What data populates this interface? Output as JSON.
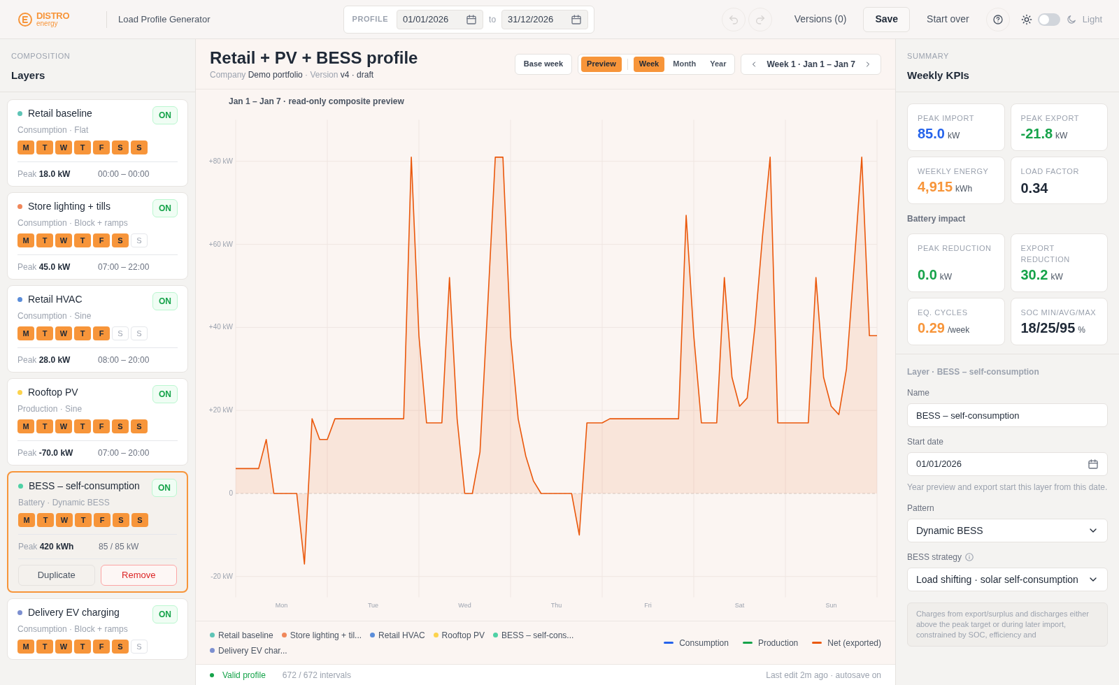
{
  "brand": {
    "name": "DISTRO",
    "sub": "energy"
  },
  "app_title": "Load Profile Generator",
  "profile_range": {
    "label": "PROFILE",
    "from": "01/01/2026",
    "to_label": "to",
    "to": "31/12/2026"
  },
  "toolbar": {
    "undo_disabled": true,
    "redo_disabled": true,
    "versions": "Versions (0)",
    "save": "Save",
    "start_over": "Start over",
    "theme_label": "Light",
    "dark": false
  },
  "sidebar": {
    "eyebrow": "COMPOSITION",
    "title": "Layers",
    "layers": [
      {
        "name": "Retail baseline",
        "color": "#5ec4b6",
        "subtitle": "Consumption · Flat",
        "on": true,
        "on_label": "ON",
        "selected": false,
        "days": [
          {
            "label": "M",
            "active": true
          },
          {
            "label": "T",
            "active": true
          },
          {
            "label": "W",
            "active": true
          },
          {
            "label": "T",
            "active": true
          },
          {
            "label": "F",
            "active": true
          },
          {
            "label": "S",
            "active": true
          },
          {
            "label": "S",
            "active": true
          }
        ],
        "peak_label": "Peak",
        "peak": "18.0 kW",
        "detail": "00:00 – 00:00"
      },
      {
        "name": "Store lighting + tills",
        "color": "#f0875a",
        "subtitle": "Consumption · Block + ramps",
        "on": true,
        "on_label": "ON",
        "selected": false,
        "days": [
          {
            "label": "M",
            "active": true
          },
          {
            "label": "T",
            "active": true
          },
          {
            "label": "W",
            "active": true
          },
          {
            "label": "T",
            "active": true
          },
          {
            "label": "F",
            "active": true
          },
          {
            "label": "S",
            "active": true
          },
          {
            "label": "S",
            "active": false
          }
        ],
        "peak_label": "Peak",
        "peak": "45.0 kW",
        "detail": "07:00 – 22:00"
      },
      {
        "name": "Retail HVAC",
        "color": "#5b8dd9",
        "subtitle": "Consumption · Sine",
        "on": true,
        "on_label": "ON",
        "selected": false,
        "days": [
          {
            "label": "M",
            "active": true
          },
          {
            "label": "T",
            "active": true
          },
          {
            "label": "W",
            "active": true
          },
          {
            "label": "T",
            "active": true
          },
          {
            "label": "F",
            "active": true
          },
          {
            "label": "S",
            "active": false
          },
          {
            "label": "S",
            "active": false
          }
        ],
        "peak_label": "Peak",
        "peak": "28.0 kW",
        "detail": "08:00 – 20:00"
      },
      {
        "name": "Rooftop PV",
        "color": "#fcd34d",
        "subtitle": "Production · Sine",
        "on": true,
        "on_label": "ON",
        "selected": false,
        "days": [
          {
            "label": "M",
            "active": true
          },
          {
            "label": "T",
            "active": true
          },
          {
            "label": "W",
            "active": true
          },
          {
            "label": "T",
            "active": true
          },
          {
            "label": "F",
            "active": true
          },
          {
            "label": "S",
            "active": true
          },
          {
            "label": "S",
            "active": true
          }
        ],
        "peak_label": "Peak",
        "peak": "-70.0 kW",
        "detail": "07:00 – 20:00"
      },
      {
        "name": "BESS – self-consumption",
        "color": "#4fd1a5",
        "subtitle": "Battery · Dynamic BESS",
        "on": true,
        "on_label": "ON",
        "selected": true,
        "days": [
          {
            "label": "M",
            "active": true
          },
          {
            "label": "T",
            "active": true
          },
          {
            "label": "W",
            "active": true
          },
          {
            "label": "T",
            "active": true
          },
          {
            "label": "F",
            "active": true
          },
          {
            "label": "S",
            "active": true
          },
          {
            "label": "S",
            "active": true
          }
        ],
        "peak_label": "Peak",
        "peak": "420 kWh",
        "detail": "85 / 85 kW",
        "actions": [
          {
            "label": "Duplicate",
            "kind": "secondary"
          },
          {
            "label": "Remove",
            "kind": "danger"
          }
        ]
      },
      {
        "name": "Delivery EV charging",
        "color": "#7c8fd0",
        "subtitle": "Consumption · Block + ramps",
        "on": true,
        "on_label": "ON",
        "selected": false,
        "days": [
          {
            "label": "M",
            "active": true
          },
          {
            "label": "T",
            "active": true
          },
          {
            "label": "W",
            "active": true
          },
          {
            "label": "T",
            "active": true
          },
          {
            "label": "F",
            "active": true
          },
          {
            "label": "S",
            "active": true
          },
          {
            "label": "S",
            "active": false
          }
        ]
      }
    ]
  },
  "main": {
    "title": "Retail + PV + BESS profile",
    "meta_separator": "·",
    "meta": [
      {
        "label": "Company",
        "value": "Demo portfolio"
      },
      {
        "label": "Version",
        "value": "v4 · draft"
      }
    ],
    "base_week": "Base week",
    "preview": {
      "label": "Preview",
      "selected": true
    },
    "views": [
      {
        "label": "Week",
        "selected": true
      },
      {
        "label": "Month",
        "selected": false
      },
      {
        "label": "Year",
        "selected": false
      }
    ],
    "week_nav": "Week 1 · Jan 1 – Jan 7",
    "chart_caption": "Jan 1 – Jan 7 · read-only composite preview",
    "chart_data": {
      "type": "area",
      "categories": [
        null,
        null,
        null,
        null,
        null,
        null,
        "Mon",
        null,
        null,
        null,
        null,
        null,
        null,
        null,
        null,
        null,
        null,
        null,
        "Tue",
        null,
        null,
        null,
        null,
        null,
        null,
        null,
        null,
        null,
        null,
        null,
        "Wed",
        null,
        null,
        null,
        null,
        null,
        null,
        null,
        null,
        null,
        null,
        null,
        "Thu",
        null,
        null,
        null,
        null,
        null,
        null,
        null,
        null,
        null,
        null,
        null,
        "Fri",
        null,
        null,
        null,
        null,
        null,
        null,
        null,
        null,
        null,
        null,
        null,
        "Sat",
        null,
        null,
        null,
        null,
        null,
        null,
        null,
        null,
        null,
        null,
        null,
        "Sun",
        null,
        null,
        null,
        null,
        null,
        null
      ],
      "series": [
        {
          "name": "Net (exported)",
          "color": "#ea580c",
          "values": [
            6,
            6,
            6,
            6,
            13,
            0,
            0,
            0,
            0,
            -17,
            18,
            13,
            13,
            18,
            18,
            18,
            18,
            18,
            18,
            18,
            18,
            18,
            18,
            81,
            38,
            17,
            17,
            17,
            52,
            18,
            0,
            0,
            10,
            45,
            81,
            81,
            38,
            18,
            9,
            3,
            0,
            0,
            0,
            0,
            0,
            -10,
            17,
            17,
            17,
            18,
            18,
            18,
            18,
            18,
            18,
            18,
            18,
            18,
            18,
            67,
            38,
            17,
            17,
            17,
            52,
            28,
            21,
            23,
            40,
            62,
            81,
            17,
            17,
            17,
            17,
            17,
            52,
            28,
            21,
            19,
            30,
            55,
            81,
            38,
            38
          ]
        }
      ],
      "ylim": [
        -25,
        90
      ],
      "grid": true,
      "ref_lines": [
        {
          "axis": "y",
          "value": 0
        }
      ],
      "yticks": [
        {
          "value": -20,
          "label": "-20 kW"
        },
        {
          "value": 0,
          "label": "0"
        },
        {
          "value": 20,
          "label": "+20 kW"
        },
        {
          "value": 40,
          "label": "+40 kW"
        },
        {
          "value": 60,
          "label": "+60 kW"
        },
        {
          "value": 80,
          "label": "+80 kW"
        }
      ]
    },
    "layer_legend": [
      {
        "label": "Retail baseline",
        "color": "#5ec4b6"
      },
      {
        "label": "Store lighting + til...",
        "color": "#f0875a"
      },
      {
        "label": "Retail HVAC",
        "color": "#5b8dd9"
      },
      {
        "label": "Rooftop PV",
        "color": "#fcd34d"
      },
      {
        "label": "BESS – self-cons...",
        "color": "#4fd1a5"
      },
      {
        "label": "Delivery EV char...",
        "color": "#7c8fd0"
      }
    ],
    "series_legend": [
      {
        "label": "Consumption",
        "color": "#2563eb"
      },
      {
        "label": "Production",
        "color": "#16a34a"
      }
    ],
    "status": {
      "valid": true,
      "valid_label": "Valid profile",
      "intervals": "672 / 672 intervals",
      "last_edit": "Last edit 2m ago · autosave on"
    }
  },
  "summary": {
    "eyebrow": "SUMMARY",
    "title": "Weekly KPIs",
    "kpis": [
      {
        "label": "PEAK IMPORT",
        "value": "85.0",
        "unit": "kW",
        "color": "#2563eb"
      },
      {
        "label": "PEAK EXPORT",
        "value": "-21.8",
        "unit": "kW",
        "color": "#16a34a"
      },
      {
        "label": "WEEKLY ENERGY",
        "value": "4,915",
        "unit": "kWh",
        "color": "#f7953a"
      },
      {
        "label": "LOAD FACTOR",
        "value": "0.34",
        "color": "#1f2937"
      }
    ],
    "battery_title": "Battery impact",
    "battery_kpis": [
      {
        "label": "PEAK REDUCTION",
        "value": "0.0",
        "unit": "kW",
        "color": "#16a34a"
      },
      {
        "label": "EXPORT REDUCTION",
        "value": "30.2",
        "unit": "kW",
        "color": "#16a34a"
      },
      {
        "label": "EQ. CYCLES",
        "value": "0.29",
        "unit": "/week",
        "color": "#f7953a"
      },
      {
        "label": "SOC MIN/AVG/MAX",
        "value": "18/25/95",
        "unit": "%",
        "color": "#1f2937"
      }
    ]
  },
  "layer_form": {
    "heading": "Layer · BESS – self-consumption",
    "name_label": "Name",
    "name": "BESS – self-consumption",
    "start_label": "Start date",
    "start": "01/01/2026",
    "start_hint": "Year preview and export start this layer from this date.",
    "pattern_label": "Pattern",
    "pattern": "Dynamic BESS",
    "strategy_label": "BESS strategy",
    "strategy": "Load shifting · solar self-consumption",
    "note": "Charges from export/surplus and discharges either above the peak target or during later import, constrained by SOC, efficiency and"
  }
}
